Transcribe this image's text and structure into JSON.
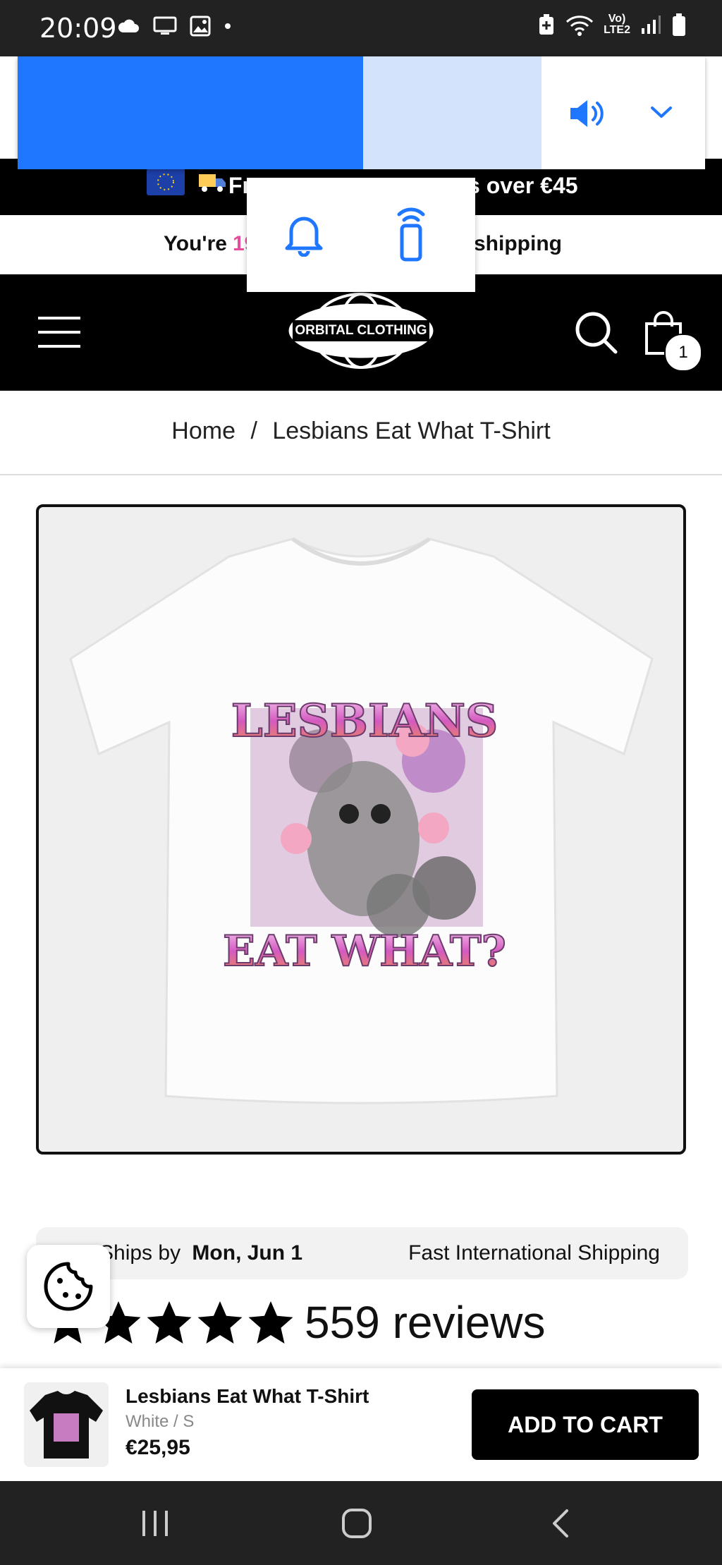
{
  "status_bar": {
    "time": "20:09",
    "network_label_top": "Vo)",
    "network_label_bottom": "LTE2",
    "icons": [
      "cloud-icon",
      "cast-screen-icon",
      "gallery-icon",
      "dot-icon",
      "battery-saver-icon",
      "wifi-icon",
      "signal-icon",
      "battery-icon"
    ]
  },
  "volume_panel": {
    "level_percent": 47,
    "icons": [
      "speaker-icon",
      "chevron-down-icon",
      "bell-icon",
      "remote-icon"
    ],
    "colors": {
      "active": "#1f76ff",
      "track": "#d3e3fc"
    }
  },
  "announcement": {
    "text_visible_left": "Fr",
    "text_visible_right": "s over €45"
  },
  "shipping_bar": {
    "prefix": "You're ",
    "amount_visible": "19",
    "suffix": "shipping"
  },
  "header": {
    "logo_text": "ORBITAL CLOTHING",
    "cart_count": "1",
    "icons": [
      "menu-icon",
      "search-icon",
      "cart-icon"
    ]
  },
  "breadcrumb": {
    "home": "Home",
    "separator": "/",
    "current": "Lesbians Eat What T-Shirt"
  },
  "product_image": {
    "graphic_top": "LESBIANS",
    "graphic_bottom": "EAT WHAT?"
  },
  "ships": {
    "label": "Ships by",
    "date": "Mon, Jun 1",
    "right": "Fast International Shipping"
  },
  "reviews": {
    "stars": 5,
    "count_text": "559 reviews"
  },
  "sticky_cart": {
    "name": "Lesbians Eat What T-Shirt",
    "variant": "White / S",
    "price": "€25,95",
    "button": "ADD TO CART"
  },
  "navbar": {
    "icons": [
      "recent-apps-icon",
      "home-icon",
      "back-icon"
    ]
  }
}
